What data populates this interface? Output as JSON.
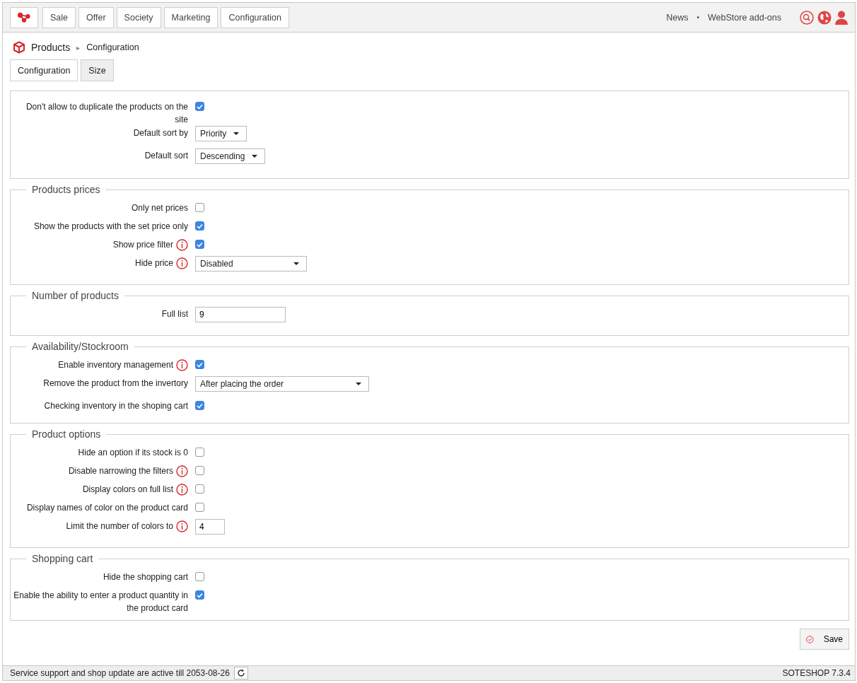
{
  "top_menu": [
    {
      "label": "Sale"
    },
    {
      "label": "Offer"
    },
    {
      "label": "Society"
    },
    {
      "label": "Marketing"
    },
    {
      "label": "Configuration"
    }
  ],
  "top_links": [
    {
      "label": "News"
    },
    {
      "label": "WebStore add-ons"
    }
  ],
  "top_links_separator": "•",
  "breadcrumb": {
    "module": "Products",
    "separator": "▸",
    "page": "Configuration"
  },
  "tabs": [
    {
      "label": "Configuration",
      "selected": true
    },
    {
      "label": "Size",
      "selected": false
    }
  ],
  "sections": [
    {
      "rows": [
        {
          "kind": "checkbox",
          "label": "Don't allow to duplicate the products on the site",
          "info": false,
          "checked": true
        },
        {
          "kind": "select",
          "label": "Default sort by",
          "info": false,
          "value": "Priority"
        },
        {
          "kind": "select",
          "label": "Default sort",
          "info": false,
          "value": "Descending"
        }
      ]
    },
    {
      "legend": "Products prices",
      "rows": [
        {
          "kind": "checkbox",
          "label": "Only net prices",
          "info": false,
          "checked": false
        },
        {
          "kind": "checkbox",
          "label": "Show the products with the set price only",
          "info": false,
          "checked": true
        },
        {
          "kind": "checkbox",
          "label": "Show price filter",
          "info": true,
          "checked": true
        },
        {
          "kind": "select",
          "label": "Hide price",
          "info": true,
          "value": "Disabled"
        }
      ]
    },
    {
      "legend": "Number of products",
      "rows": [
        {
          "kind": "text",
          "label": "Full list",
          "info": false,
          "value": "9"
        }
      ]
    },
    {
      "legend": "Availability/Stockroom",
      "rows": [
        {
          "kind": "checkbox",
          "label": "Enable inventory management",
          "info": true,
          "checked": true
        },
        {
          "kind": "select",
          "label": "Remove the product from the invertory",
          "info": false,
          "value": "After placing the order"
        },
        {
          "kind": "checkbox",
          "label": "Checking inventory in the shoping cart",
          "info": false,
          "checked": true
        }
      ]
    },
    {
      "legend": "Product options",
      "rows": [
        {
          "kind": "checkbox",
          "label": "Hide an option if its stock is 0",
          "info": false,
          "checked": false
        },
        {
          "kind": "checkbox",
          "label": "Disable narrowing the filters",
          "info": true,
          "checked": false
        },
        {
          "kind": "checkbox",
          "label": "Display colors on full list",
          "info": true,
          "checked": false
        },
        {
          "kind": "checkbox",
          "label": "Display names of color on the product card",
          "info": false,
          "checked": false
        },
        {
          "kind": "text",
          "label": "Limit the number of colors to",
          "info": true,
          "value": "4"
        }
      ]
    },
    {
      "legend": "Shopping cart",
      "rows": [
        {
          "kind": "checkbox",
          "label": "Hide the shopping cart",
          "info": false,
          "checked": false
        },
        {
          "kind": "checkbox",
          "label": "Enable the ability to enter a product quantity in the product card",
          "info": false,
          "checked": true
        }
      ]
    }
  ],
  "save_button": {
    "label": "Save"
  },
  "status_bar": {
    "message": "Service support and shop update are active till 2053-08-26",
    "version": "SOTESHOP 7.3.4"
  }
}
